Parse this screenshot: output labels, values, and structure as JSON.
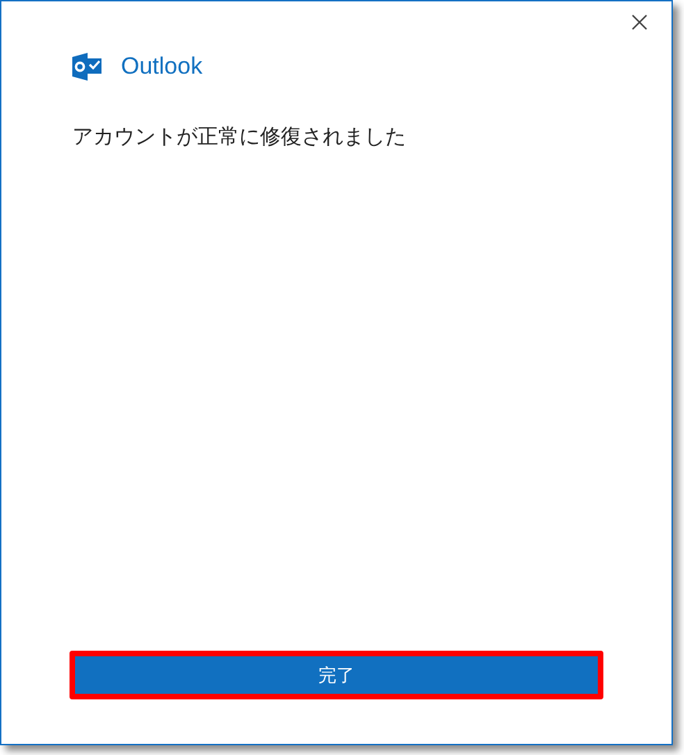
{
  "header": {
    "app_name": "Outlook"
  },
  "message": "アカウントが正常に修復されました",
  "button": {
    "label": "完了",
    "highlighted": true
  }
}
